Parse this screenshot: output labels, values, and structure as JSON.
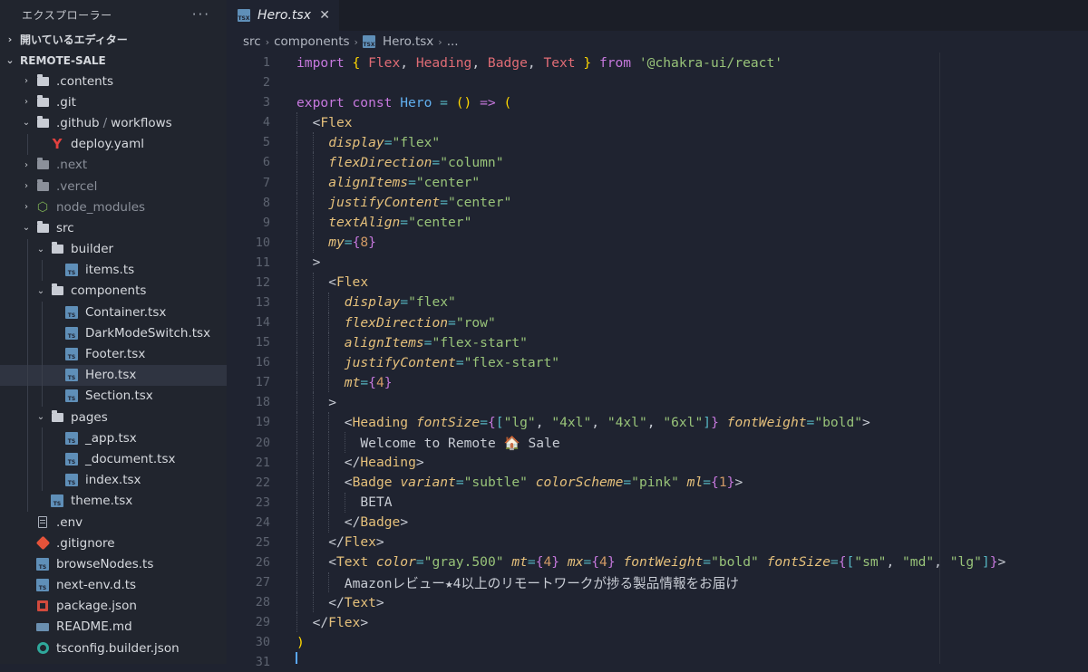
{
  "sidebar": {
    "title": "エクスプローラー",
    "more": "···",
    "open_editors": "開いているエディター",
    "project": "REMOTE-SALE",
    "items": [
      {
        "label": ".contents",
        "type": "folder",
        "depth": 0,
        "twist": "›",
        "dim": false
      },
      {
        "label": ".git",
        "type": "folder",
        "depth": 0,
        "twist": "›",
        "dim": false
      },
      {
        "label": ".github",
        "type": "folder",
        "depth": 0,
        "twist": "⌄",
        "dim": false,
        "sub": "workflows"
      },
      {
        "label": "deploy.yaml",
        "type": "yaml",
        "depth": 1,
        "twist": "",
        "dim": false
      },
      {
        "label": ".next",
        "type": "folder",
        "depth": 0,
        "twist": "›",
        "dim": true
      },
      {
        "label": ".vercel",
        "type": "folder",
        "depth": 0,
        "twist": "›",
        "dim": true
      },
      {
        "label": "node_modules",
        "type": "node",
        "depth": 0,
        "twist": "›",
        "dim": true
      },
      {
        "label": "src",
        "type": "folder",
        "depth": 0,
        "twist": "⌄",
        "dim": false
      },
      {
        "label": "builder",
        "type": "folder",
        "depth": 1,
        "twist": "⌄",
        "dim": false
      },
      {
        "label": "items.ts",
        "type": "ts",
        "depth": 2,
        "twist": "",
        "dim": false
      },
      {
        "label": "components",
        "type": "folder",
        "depth": 1,
        "twist": "⌄",
        "dim": false
      },
      {
        "label": "Container.tsx",
        "type": "tsx",
        "depth": 2,
        "twist": "",
        "dim": false
      },
      {
        "label": "DarkModeSwitch.tsx",
        "type": "tsx",
        "depth": 2,
        "twist": "",
        "dim": false
      },
      {
        "label": "Footer.tsx",
        "type": "tsx",
        "depth": 2,
        "twist": "",
        "dim": false
      },
      {
        "label": "Hero.tsx",
        "type": "tsx",
        "depth": 2,
        "twist": "",
        "dim": false,
        "active": true
      },
      {
        "label": "Section.tsx",
        "type": "tsx",
        "depth": 2,
        "twist": "",
        "dim": false
      },
      {
        "label": "pages",
        "type": "folder",
        "depth": 1,
        "twist": "⌄",
        "dim": false
      },
      {
        "label": "_app.tsx",
        "type": "tsx",
        "depth": 2,
        "twist": "",
        "dim": false
      },
      {
        "label": "_document.tsx",
        "type": "tsx",
        "depth": 2,
        "twist": "",
        "dim": false
      },
      {
        "label": "index.tsx",
        "type": "tsx",
        "depth": 2,
        "twist": "",
        "dim": false
      },
      {
        "label": "theme.tsx",
        "type": "tsx",
        "depth": 1,
        "twist": "",
        "dim": false
      },
      {
        "label": ".env",
        "type": "file",
        "depth": 0,
        "twist": "",
        "dim": false
      },
      {
        "label": ".gitignore",
        "type": "git",
        "depth": 0,
        "twist": "",
        "dim": false
      },
      {
        "label": "browseNodes.ts",
        "type": "ts",
        "depth": 0,
        "twist": "",
        "dim": false
      },
      {
        "label": "next-env.d.ts",
        "type": "ts",
        "depth": 0,
        "twist": "",
        "dim": false
      },
      {
        "label": "package.json",
        "type": "json",
        "depth": 0,
        "twist": "",
        "dim": false
      },
      {
        "label": "README.md",
        "type": "md",
        "depth": 0,
        "twist": "",
        "dim": false
      },
      {
        "label": "tsconfig.builder.json",
        "type": "tsconfig",
        "depth": 0,
        "twist": "",
        "dim": false
      }
    ]
  },
  "editor": {
    "tab": {
      "label": "Hero.tsx",
      "close": "✕",
      "icon": "TSX"
    },
    "breadcrumb": [
      "src",
      "components",
      "Hero.tsx",
      "..."
    ],
    "lines": [
      {
        "n": "1",
        "indent": 0,
        "tokens": [
          [
            "kw",
            "import "
          ],
          [
            "brace-y",
            "{ "
          ],
          [
            "imp",
            "Flex"
          ],
          [
            "punct",
            ", "
          ],
          [
            "imp",
            "Heading"
          ],
          [
            "punct",
            ", "
          ],
          [
            "imp",
            "Badge"
          ],
          [
            "punct",
            ", "
          ],
          [
            "imp",
            "Text "
          ],
          [
            "brace-y",
            "} "
          ],
          [
            "kw",
            "from "
          ],
          [
            "str",
            "'@chakra-ui/react'"
          ]
        ]
      },
      {
        "n": "2",
        "indent": 0,
        "tokens": []
      },
      {
        "n": "3",
        "indent": 0,
        "tokens": [
          [
            "kw",
            "export const "
          ],
          [
            "fn",
            "Hero "
          ],
          [
            "op",
            "= "
          ],
          [
            "brace-y",
            "() "
          ],
          [
            "kw",
            "=> "
          ],
          [
            "brace-y",
            "("
          ]
        ]
      },
      {
        "n": "4",
        "indent": 1,
        "tokens": [
          [
            "punct",
            "<"
          ],
          [
            "tag",
            "Flex"
          ]
        ]
      },
      {
        "n": "5",
        "indent": 2,
        "tokens": [
          [
            "attr",
            "display"
          ],
          [
            "op",
            "="
          ],
          [
            "str",
            "\"flex\""
          ]
        ]
      },
      {
        "n": "6",
        "indent": 2,
        "tokens": [
          [
            "attr",
            "flexDirection"
          ],
          [
            "op",
            "="
          ],
          [
            "str",
            "\"column\""
          ]
        ]
      },
      {
        "n": "7",
        "indent": 2,
        "tokens": [
          [
            "attr",
            "alignItems"
          ],
          [
            "op",
            "="
          ],
          [
            "str",
            "\"center\""
          ]
        ]
      },
      {
        "n": "8",
        "indent": 2,
        "tokens": [
          [
            "attr",
            "justifyContent"
          ],
          [
            "op",
            "="
          ],
          [
            "str",
            "\"center\""
          ]
        ]
      },
      {
        "n": "9",
        "indent": 2,
        "tokens": [
          [
            "attr",
            "textAlign"
          ],
          [
            "op",
            "="
          ],
          [
            "str",
            "\"center\""
          ]
        ]
      },
      {
        "n": "10",
        "indent": 2,
        "tokens": [
          [
            "attr",
            "my"
          ],
          [
            "op",
            "="
          ],
          [
            "brace",
            "{"
          ],
          [
            "num",
            "8"
          ],
          [
            "brace",
            "}"
          ]
        ]
      },
      {
        "n": "11",
        "indent": 1,
        "tokens": [
          [
            "punct",
            ">"
          ]
        ]
      },
      {
        "n": "12",
        "indent": 2,
        "tokens": [
          [
            "punct",
            "<"
          ],
          [
            "tag",
            "Flex"
          ]
        ]
      },
      {
        "n": "13",
        "indent": 3,
        "tokens": [
          [
            "attr",
            "display"
          ],
          [
            "op",
            "="
          ],
          [
            "str",
            "\"flex\""
          ]
        ]
      },
      {
        "n": "14",
        "indent": 3,
        "tokens": [
          [
            "attr",
            "flexDirection"
          ],
          [
            "op",
            "="
          ],
          [
            "str",
            "\"row\""
          ]
        ]
      },
      {
        "n": "15",
        "indent": 3,
        "tokens": [
          [
            "attr",
            "alignItems"
          ],
          [
            "op",
            "="
          ],
          [
            "str",
            "\"flex-start\""
          ]
        ]
      },
      {
        "n": "16",
        "indent": 3,
        "tokens": [
          [
            "attr",
            "justifyContent"
          ],
          [
            "op",
            "="
          ],
          [
            "str",
            "\"flex-start\""
          ]
        ]
      },
      {
        "n": "17",
        "indent": 3,
        "tokens": [
          [
            "attr",
            "mt"
          ],
          [
            "op",
            "="
          ],
          [
            "brace",
            "{"
          ],
          [
            "num",
            "4"
          ],
          [
            "brace",
            "}"
          ]
        ]
      },
      {
        "n": "18",
        "indent": 2,
        "tokens": [
          [
            "punct",
            ">"
          ]
        ]
      },
      {
        "n": "19",
        "indent": 3,
        "tokens": [
          [
            "punct",
            "<"
          ],
          [
            "tag",
            "Heading "
          ],
          [
            "attr",
            "fontSize"
          ],
          [
            "op",
            "="
          ],
          [
            "brace",
            "{"
          ],
          [
            "brk",
            "["
          ],
          [
            "str",
            "\"lg\""
          ],
          [
            "punct",
            ", "
          ],
          [
            "str",
            "\"4xl\""
          ],
          [
            "punct",
            ", "
          ],
          [
            "str",
            "\"4xl\""
          ],
          [
            "punct",
            ", "
          ],
          [
            "str",
            "\"6xl\""
          ],
          [
            "brk",
            "]"
          ],
          [
            "brace",
            "} "
          ],
          [
            "attr",
            "fontWeight"
          ],
          [
            "op",
            "="
          ],
          [
            "str",
            "\"bold\""
          ],
          [
            "punct",
            ">"
          ]
        ]
      },
      {
        "n": "20",
        "indent": 4,
        "tokens": [
          [
            "txt",
            "Welcome to Remote 🏠 Sale"
          ]
        ]
      },
      {
        "n": "21",
        "indent": 3,
        "tokens": [
          [
            "punct",
            "</"
          ],
          [
            "tag",
            "Heading"
          ],
          [
            "punct",
            ">"
          ]
        ]
      },
      {
        "n": "22",
        "indent": 3,
        "tokens": [
          [
            "punct",
            "<"
          ],
          [
            "tag",
            "Badge "
          ],
          [
            "attr",
            "variant"
          ],
          [
            "op",
            "="
          ],
          [
            "str",
            "\"subtle\" "
          ],
          [
            "attr",
            "colorScheme"
          ],
          [
            "op",
            "="
          ],
          [
            "str",
            "\"pink\" "
          ],
          [
            "attr",
            "ml"
          ],
          [
            "op",
            "="
          ],
          [
            "brace",
            "{"
          ],
          [
            "num",
            "1"
          ],
          [
            "brace",
            "}"
          ],
          [
            "punct",
            ">"
          ]
        ]
      },
      {
        "n": "23",
        "indent": 4,
        "tokens": [
          [
            "txt",
            "BETA"
          ]
        ]
      },
      {
        "n": "24",
        "indent": 3,
        "tokens": [
          [
            "punct",
            "</"
          ],
          [
            "tag",
            "Badge"
          ],
          [
            "punct",
            ">"
          ]
        ]
      },
      {
        "n": "25",
        "indent": 2,
        "tokens": [
          [
            "punct",
            "</"
          ],
          [
            "tag",
            "Flex"
          ],
          [
            "punct",
            ">"
          ]
        ]
      },
      {
        "n": "26",
        "indent": 2,
        "tokens": [
          [
            "punct",
            "<"
          ],
          [
            "tag",
            "Text "
          ],
          [
            "attr",
            "color"
          ],
          [
            "op",
            "="
          ],
          [
            "str",
            "\"gray.500\" "
          ],
          [
            "attr",
            "mt"
          ],
          [
            "op",
            "="
          ],
          [
            "brace",
            "{"
          ],
          [
            "num",
            "4"
          ],
          [
            "brace",
            "} "
          ],
          [
            "attr",
            "mx"
          ],
          [
            "op",
            "="
          ],
          [
            "brace",
            "{"
          ],
          [
            "num",
            "4"
          ],
          [
            "brace",
            "} "
          ],
          [
            "attr",
            "fontWeight"
          ],
          [
            "op",
            "="
          ],
          [
            "str",
            "\"bold\" "
          ],
          [
            "attr",
            "fontSize"
          ],
          [
            "op",
            "="
          ],
          [
            "brace",
            "{"
          ],
          [
            "brk",
            "["
          ],
          [
            "str",
            "\"sm\""
          ],
          [
            "punct",
            ", "
          ],
          [
            "str",
            "\"md\""
          ],
          [
            "punct",
            ", "
          ],
          [
            "str",
            "\"lg\""
          ],
          [
            "brk",
            "]"
          ],
          [
            "brace",
            "}"
          ],
          [
            "punct",
            ">"
          ]
        ]
      },
      {
        "n": "27",
        "indent": 3,
        "tokens": [
          [
            "txt",
            "Amazonレビュー★4以上のリモートワークが捗る製品情報をお届け"
          ]
        ]
      },
      {
        "n": "28",
        "indent": 2,
        "tokens": [
          [
            "punct",
            "</"
          ],
          [
            "tag",
            "Text"
          ],
          [
            "punct",
            ">"
          ]
        ]
      },
      {
        "n": "29",
        "indent": 1,
        "tokens": [
          [
            "punct",
            "</"
          ],
          [
            "tag",
            "Flex"
          ],
          [
            "punct",
            ">"
          ]
        ]
      },
      {
        "n": "30",
        "indent": 0,
        "tokens": [
          [
            "brace-y",
            ")"
          ]
        ]
      },
      {
        "n": "31",
        "indent": 0,
        "tokens": []
      }
    ]
  }
}
